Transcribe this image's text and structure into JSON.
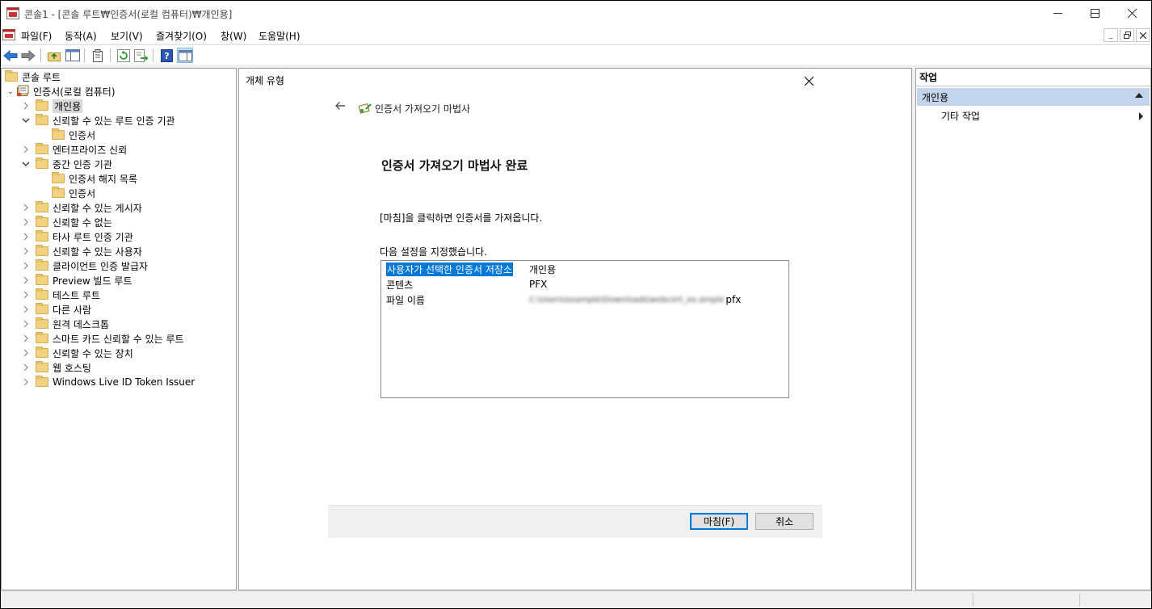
{
  "window": {
    "title": "콘솔1 - [콘솔 루트₩인증서(로컬 컴퓨터)₩개인용]",
    "controls": {
      "minimize": "─",
      "maximize": "☐",
      "close": "✕"
    }
  },
  "menubar": {
    "items": [
      "파일(F)",
      "동작(A)",
      "보기(V)",
      "즐겨찾기(O)",
      "창(W)",
      "도움말(H)"
    ],
    "mdi_controls": {
      "minimize": "_",
      "restore": "🗗",
      "close": "✕"
    }
  },
  "toolbar": {
    "buttons": [
      "back-icon",
      "forward-icon",
      "up-folder-icon",
      "show-hide-tree-icon",
      "properties-icon",
      "refresh-icon",
      "export-list-icon",
      "help-icon",
      "show-hide-action-pane-icon"
    ]
  },
  "tree": {
    "root": "콘솔 루트",
    "store": "인증서(로컬 컴퓨터)",
    "nodes": [
      {
        "label": "개인용",
        "expanded": false,
        "selected": true
      },
      {
        "label": "신뢰할 수 있는 루트 인증 기관",
        "expanded": true
      },
      {
        "label": "인증서",
        "child": true
      },
      {
        "label": "엔터프라이즈 신뢰",
        "expanded": false
      },
      {
        "label": "중간 인증 기관",
        "expanded": true
      },
      {
        "label": "인증서 해지 목록",
        "child": true
      },
      {
        "label": "인증서",
        "child": true
      },
      {
        "label": "신뢰할 수 있는 게시자",
        "expanded": false
      },
      {
        "label": "신뢰할 수 없는",
        "expanded": false
      },
      {
        "label": "타사 루트 인증 기관",
        "expanded": false
      },
      {
        "label": "신뢰할 수 있는 사용자",
        "expanded": false
      },
      {
        "label": "클라이언트 인증 발급자",
        "expanded": false
      },
      {
        "label": "Preview 빌드 루트",
        "expanded": false
      },
      {
        "label": "테스트 루트",
        "expanded": false
      },
      {
        "label": "다른 사람",
        "expanded": false
      },
      {
        "label": "원격 데스크톱",
        "expanded": false
      },
      {
        "label": "스마트 카드 신뢰할 수 있는 루트",
        "expanded": false
      },
      {
        "label": "신뢰할 수 있는 장치",
        "expanded": false
      },
      {
        "label": "웹 호스팅",
        "expanded": false
      },
      {
        "label": "Windows Live ID Token Issuer",
        "expanded": false
      }
    ]
  },
  "center": {
    "object_type": "개체 유형",
    "wizard_title": "인증서 가져오기 마법사",
    "heading": "인증서 가져오기 마법사 완료",
    "description": "[마침]을 클릭하면 인증서를 가져옵니다.",
    "settings_label": "다음 설정을 지정했습니다.",
    "settings": [
      {
        "key": "사용자가 선택한 인증서 저장소",
        "value": "개인용",
        "selected": true
      },
      {
        "key": "콘텐츠",
        "value": "PFX"
      },
      {
        "key": "파일 이름",
        "value_blurred": "C:\\Users\\example\\Downloads\\webcert_ex.ample",
        "value_suffix": "pfx"
      }
    ],
    "finish_button": "마침(F)",
    "cancel_button": "취소"
  },
  "actions": {
    "header": "작업",
    "group": "개인용",
    "item": "기타 작업"
  }
}
